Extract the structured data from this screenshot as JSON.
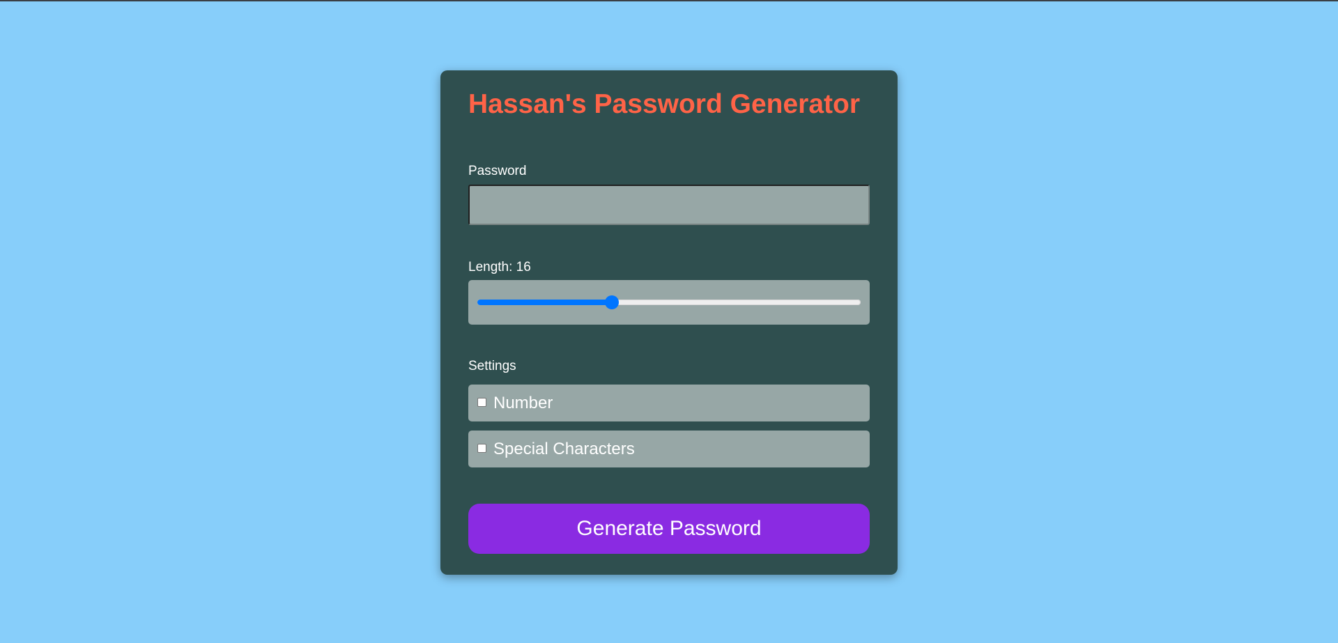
{
  "page": {
    "background_color": "#87cefa"
  },
  "card": {
    "background_color": "#2f4f4f",
    "title": "Hassan's Password Generator",
    "title_color": "#ff6347"
  },
  "password": {
    "label": "Password",
    "value": ""
  },
  "length": {
    "label": "Length: 16",
    "value": 16,
    "slider_fill_fraction": 0.35,
    "slider_color": "#0075ff"
  },
  "settings": {
    "label": "Settings",
    "options": [
      {
        "label": "Number",
        "checked": false
      },
      {
        "label": "Special Characters",
        "checked": false
      }
    ]
  },
  "generate_button": {
    "label": "Generate Password",
    "color": "#8a2be2"
  }
}
